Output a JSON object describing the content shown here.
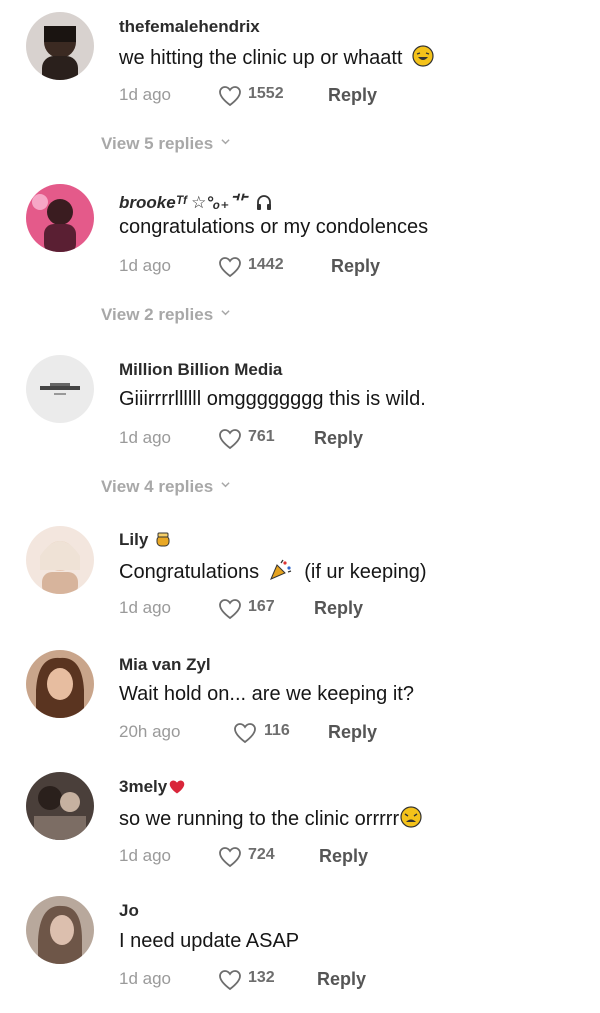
{
  "comments": [
    {
      "username": "thefemalehendrix",
      "text": "we hitting the clinic up or whaatt",
      "emoji": "laughing-face-icon",
      "time": "1d ago",
      "likes": "1552",
      "reply": "Reply",
      "view_replies": "View 5 replies"
    },
    {
      "username": "brookeᵀᶠ ☆°ₒ₊⻀",
      "text": "congratulations or my condolences",
      "emoji": "headphones-icon",
      "time": "1d ago",
      "likes": "1442",
      "reply": "Reply",
      "view_replies": "View 2 replies"
    },
    {
      "username": "Million Billion Media",
      "text": "Giiirrrrllllll omgggggggg this is wild.",
      "time": "1d ago",
      "likes": "761",
      "reply": "Reply",
      "view_replies": "View 4 replies"
    },
    {
      "username": "Lily",
      "text": "Congratulations",
      "text_suffix": "(if ur keeping)",
      "username_emoji": "honey-pot-icon",
      "emoji": "party-popper-icon",
      "time": "1d ago",
      "likes": "167",
      "reply": "Reply"
    },
    {
      "username": "Mia van Zyl",
      "text": "Wait hold on... are we keeping it?",
      "time": "20h ago",
      "likes": "116",
      "reply": "Reply"
    },
    {
      "username": "3mely",
      "username_emoji": "heart-icon",
      "text": "so we running to the clinic orrrrr",
      "emoji": "weary-face-icon",
      "time": "1d ago",
      "likes": "724",
      "reply": "Reply"
    },
    {
      "username": "Jo",
      "text": "I need update ASAP",
      "time": "1d ago",
      "likes": "132",
      "reply": "Reply"
    }
  ],
  "colors": {
    "text": "#161616",
    "meta": "#9a9a9a",
    "view_replies": "#a8a8a8"
  }
}
